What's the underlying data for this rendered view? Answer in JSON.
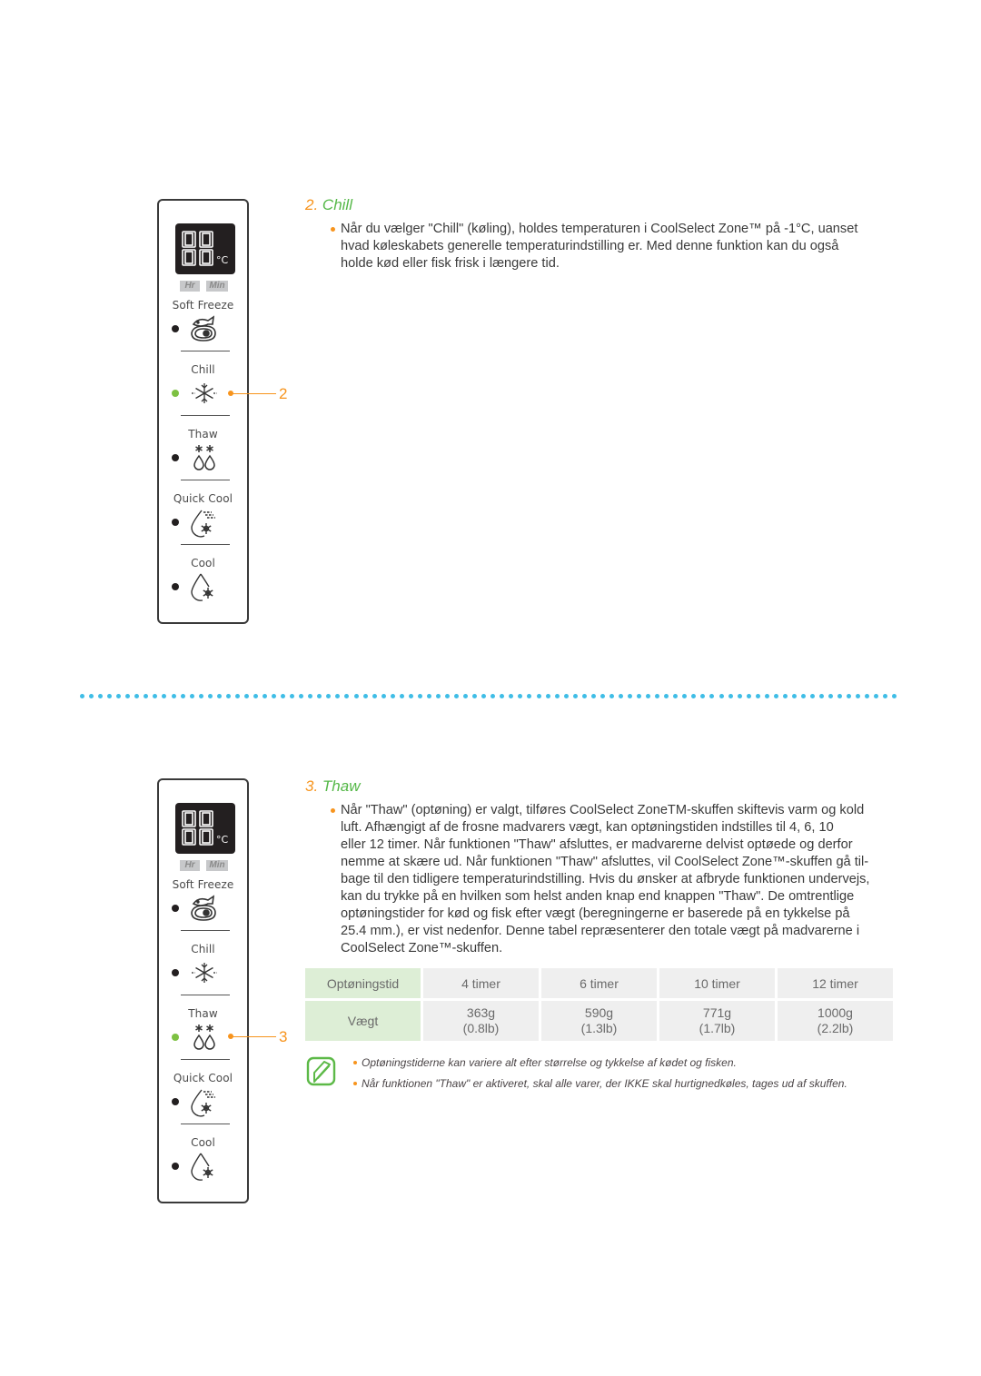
{
  "panel": {
    "display_digits": "88",
    "display_unit": "°C",
    "hr_label": "Hr",
    "min_label": "Min",
    "modes": [
      {
        "label": "Soft Freeze",
        "icon": "fish-meat-icon"
      },
      {
        "label": "Chill",
        "icon": "chill-snowflake-icon"
      },
      {
        "label": "Thaw",
        "icon": "thaw-drops-icon"
      },
      {
        "label": "Quick Cool",
        "icon": "quick-cool-drop-icon"
      },
      {
        "label": "Cool",
        "icon": "cool-drop-icon"
      }
    ]
  },
  "colors": {
    "accent_orange": "#f7941d",
    "accent_green": "#55b848",
    "led_on": "#7dc142",
    "divider_blue": "#3fbde6",
    "table_header_bg": "#ddeed6",
    "table_cell_bg": "#efefef"
  },
  "section_chill": {
    "number": "2.",
    "title": "Chill",
    "callout": "2",
    "active_mode": "Chill",
    "lines": [
      "Når du vælger \"Chill\" (køling), holdes temperaturen i CoolSelect Zone™ på -1°C, uanset",
      "hvad køleskabets generelle temperaturindstilling er. Med denne funktion kan du også",
      "holde kød eller fisk frisk i længere tid."
    ]
  },
  "section_thaw": {
    "number": "3.",
    "title": "Thaw",
    "callout": "3",
    "active_mode": "Thaw",
    "lines": [
      "Når \"Thaw\" (optøning) er valgt, tilføres CoolSelect ZoneTM-skuffen skiftevis varm og kold",
      "luft. Afhængigt af de frosne madvarers vægt, kan optøningstiden indstilles til 4, 6, 10",
      "eller 12 timer. Når funktionen \"Thaw\" afsluttes, er madvarerne delvist optøede og derfor",
      "nemme at skære ud. Når funktionen \"Thaw\" afsluttes, vil CoolSelect Zone™-skuffen gå til-",
      "bage til den tidligere temperaturindstilling. Hvis du ønsker at afbryde funktionen undervejs,",
      "kan du trykke på en hvilken som helst anden knap end knappen \"Thaw\". De omtrentlige",
      "optøningstider for kød og fisk efter vægt (beregningerne er baserede på en tykkelse på",
      "25.4 mm.), er vist nedenfor. Denne tabel repræsenterer den totale vægt på madvarerne i",
      "CoolSelect Zone™-skuffen."
    ],
    "table": {
      "row1_header": "Optøningstid",
      "row2_header": "Vægt",
      "columns": [
        {
          "time": "4 timer",
          "weight_g": "363g",
          "weight_lb": "(0.8lb)"
        },
        {
          "time": "6 timer",
          "weight_g": "590g",
          "weight_lb": "(1.3lb)"
        },
        {
          "time": "10 timer",
          "weight_g": "771g",
          "weight_lb": "(1.7lb)"
        },
        {
          "time": "12 timer",
          "weight_g": "1000g",
          "weight_lb": "(2.2lb)"
        }
      ]
    },
    "notes": [
      "Optøningstiderne kan variere alt efter størrelse og tykkelse af kødet og fisken.",
      "Når funktionen \"Thaw\" er aktiveret, skal alle varer, der IKKE skal hurtignedkøles, tages ud af skuffen."
    ]
  }
}
